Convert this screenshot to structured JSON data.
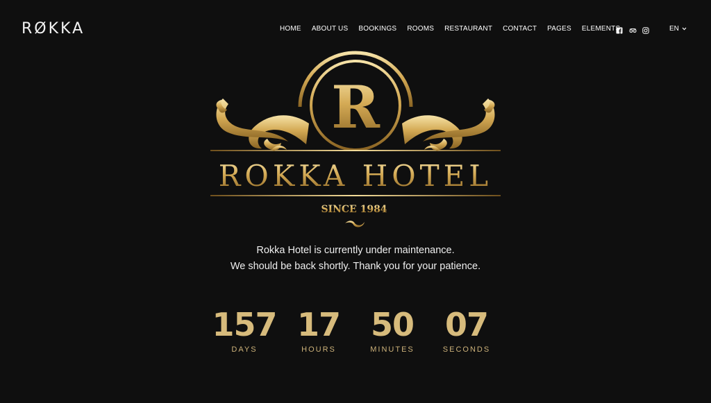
{
  "header": {
    "brand": "RØKKA",
    "nav": [
      "HOME",
      "ABOUT US",
      "BOOKINGS",
      "ROOMS",
      "RESTAURANT",
      "CONTACT",
      "PAGES",
      "ELEMENTS"
    ],
    "social_icons": [
      "facebook-icon",
      "tripadvisor-icon",
      "instagram-icon"
    ],
    "language": "EN"
  },
  "logo": {
    "monogram": "R",
    "name": "ROKKA HOTEL",
    "since": "SINCE 1984"
  },
  "message": {
    "line1": "Rokka Hotel is currently under maintenance.",
    "line2": "We should be back shortly. Thank you for your patience."
  },
  "countdown": {
    "days": {
      "value": "157",
      "label": "DAYS"
    },
    "hours": {
      "value": "17",
      "label": "HOURS"
    },
    "minutes": {
      "value": "50",
      "label": "MINUTES"
    },
    "seconds": {
      "value": "07",
      "label": "SECONDS"
    }
  },
  "colors": {
    "background": "#0f0f0f",
    "gold": "#d7bb7c"
  }
}
